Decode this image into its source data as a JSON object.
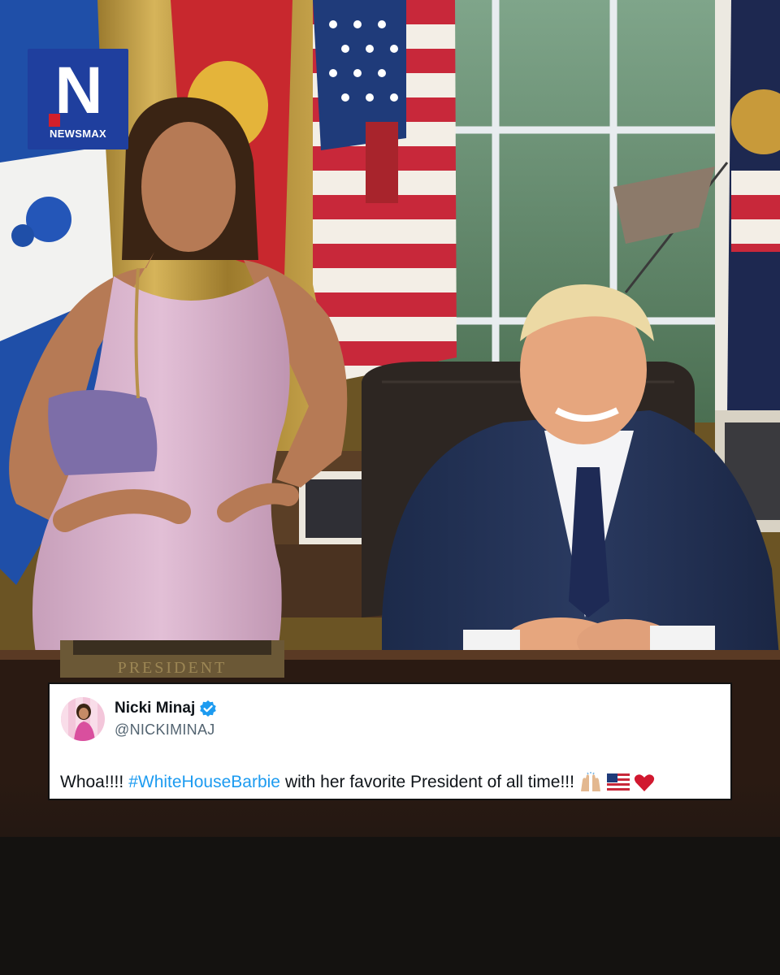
{
  "brand": {
    "letter": "N",
    "wordmark": "NEWSMAX",
    "bg_color": "#1f3f9e",
    "accent_color": "#d21f2b"
  },
  "photo": {
    "desk_plaque_text": "PRESIDENT"
  },
  "tweet": {
    "display_name": "Nicki Minaj",
    "handle": "@NICKIMINAJ",
    "text_before": "Whoa!!!!",
    "hashtag": "#WhiteHouseBarbie",
    "text_after": "with her favorite President of all time!!!",
    "emojis": [
      "raised-hands-icon",
      "us-flag-icon",
      "red-heart-icon"
    ],
    "link_color": "#1d9bf0",
    "verified_color": "#1d9bf0"
  }
}
